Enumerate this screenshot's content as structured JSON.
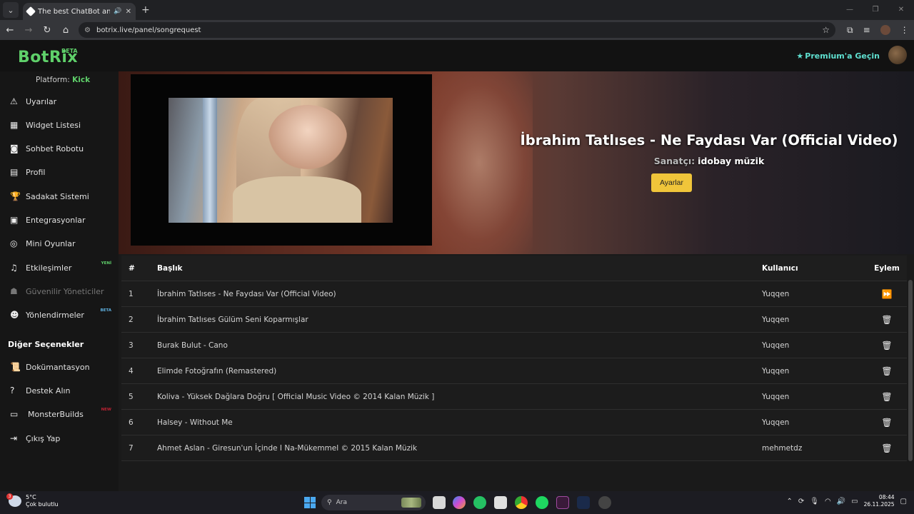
{
  "browser": {
    "tab_title": "The best ChatBot and Wid",
    "url": "botrix.live/panel/songrequest"
  },
  "app": {
    "logo": "BotRix",
    "beta": "BETA",
    "premium": "Premium'a Geçin"
  },
  "sidebar": {
    "platform_label": "Platform:",
    "platform_value": "Kick",
    "items": [
      {
        "label": "Uyarılar",
        "icon": "warning-icon"
      },
      {
        "label": "Widget Listesi",
        "icon": "grid-icon"
      },
      {
        "label": "Sohbet Robotu",
        "icon": "robot-icon"
      },
      {
        "label": "Profil",
        "icon": "id-card-icon"
      },
      {
        "label": "Sadakat Sistemi",
        "icon": "trophy-icon"
      },
      {
        "label": "Entegrasyonlar",
        "icon": "plug-icon"
      },
      {
        "label": "Mini Oyunlar",
        "icon": "gamepad-icon"
      },
      {
        "label": "Etkileşimler",
        "icon": "music-icon",
        "badge": "YENİ"
      },
      {
        "label": "Güvenilir Yöneticiler",
        "icon": "users-icon"
      },
      {
        "label": "Yönlendirmeler",
        "icon": "user-group-icon",
        "badge": "BETA"
      }
    ],
    "section_title": "Diğer Seçenekler",
    "other": [
      {
        "label": "Dokümantasyon",
        "icon": "scroll-icon"
      },
      {
        "label": "Destek Alın",
        "icon": "question-icon"
      },
      {
        "label": "MonsterBuilds",
        "icon": "laptop-icon",
        "badge": "NEW"
      },
      {
        "label": "Çıkış Yap",
        "icon": "logout-icon"
      }
    ]
  },
  "now_playing": {
    "title": "İbrahim Tatlıses - Ne Faydası Var (Official Video)",
    "artist_label": "Sanatçı:",
    "artist": "idobay müzik",
    "settings_button": "Ayarlar"
  },
  "queue": {
    "headers": {
      "num": "#",
      "title": "Başlık",
      "user": "Kullanıcı",
      "action": "Eylem"
    },
    "rows": [
      {
        "num": "1",
        "title": "İbrahim Tatlıses - Ne Faydası Var (Official Video)",
        "user": "Yuqqen",
        "action": "skip"
      },
      {
        "num": "2",
        "title": "İbrahim Tatlıses Gülüm Seni Koparmışlar",
        "user": "Yuqqen",
        "action": "delete"
      },
      {
        "num": "3",
        "title": "Burak Bulut - Cano",
        "user": "Yuqqen",
        "action": "delete"
      },
      {
        "num": "4",
        "title": "Elimde Fotoğrafın (Remastered)",
        "user": "Yuqqen",
        "action": "delete"
      },
      {
        "num": "5",
        "title": "Koliva - Yüksek Dağlara Doğru [ Official Music Video © 2014 Kalan Müzik ]",
        "user": "Yuqqen",
        "action": "delete"
      },
      {
        "num": "6",
        "title": "Halsey - Without Me",
        "user": "Yuqqen",
        "action": "delete"
      },
      {
        "num": "7",
        "title": "Ahmet Aslan - Giresun'un İçinde I Na-Mükemmel © 2015 Kalan Müzik",
        "user": "mehmetdz",
        "action": "delete"
      }
    ]
  },
  "taskbar": {
    "temp": "5°C",
    "weather": "Çok bulutlu",
    "search": "Ara",
    "time": "08:44",
    "date": "26.11.2025"
  }
}
